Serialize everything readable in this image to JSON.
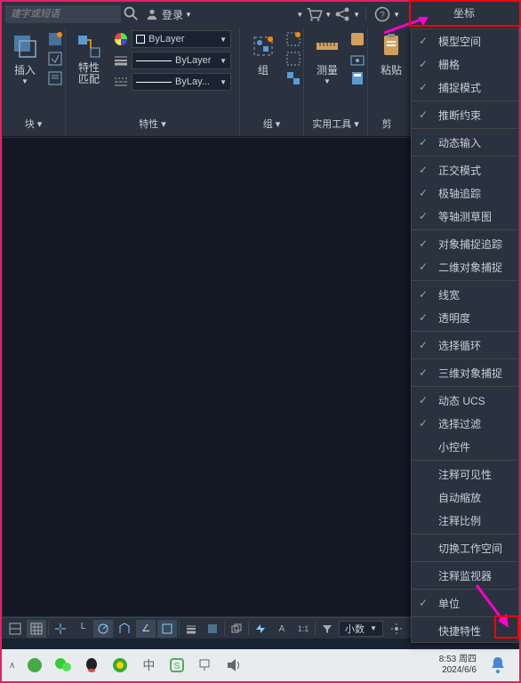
{
  "topbar": {
    "search_placeholder": "建字或短语",
    "login_label": "登录",
    "coord_label": "坐标"
  },
  "ribbon": {
    "panel_block": {
      "insert_label": "插入",
      "title": "块 ▾"
    },
    "panel_props": {
      "match_label": "特性\n匹配",
      "bylayer1": "ByLayer",
      "bylayer2": "ByLayer",
      "bylayer3": "ByLay...",
      "title": "特性 ▾"
    },
    "panel_group": {
      "group_label": "组",
      "title": "组 ▾"
    },
    "panel_tools": {
      "measure_label": "测量",
      "title": "实用工具 ▾"
    },
    "panel_clip": {
      "paste_label": "粘贴",
      "title": "剪"
    }
  },
  "status": {
    "scale_label": "小数"
  },
  "menu": {
    "items": [
      {
        "label": "模型空间",
        "checked": true,
        "sep_after": false
      },
      {
        "label": "栅格",
        "checked": true
      },
      {
        "label": "捕捉模式",
        "checked": true,
        "sep_after": true
      },
      {
        "label": "推断约束",
        "checked": true,
        "sep_after": true
      },
      {
        "label": "动态输入",
        "checked": true,
        "sep_after": true
      },
      {
        "label": "正交模式",
        "checked": true
      },
      {
        "label": "极轴追踪",
        "checked": true
      },
      {
        "label": "等轴测草图",
        "checked": true,
        "sep_after": true
      },
      {
        "label": "对象捕捉追踪",
        "checked": true
      },
      {
        "label": "二维对象捕捉",
        "checked": true,
        "sep_after": true
      },
      {
        "label": "线宽",
        "checked": true
      },
      {
        "label": "透明度",
        "checked": true,
        "sep_after": true
      },
      {
        "label": "选择循环",
        "checked": true,
        "sep_after": true
      },
      {
        "label": "三维对象捕捉",
        "checked": true,
        "sep_after": true
      },
      {
        "label": "动态 UCS",
        "checked": true
      },
      {
        "label": "选择过滤",
        "checked": true
      },
      {
        "label": "小控件",
        "checked": false,
        "sep_after": true
      },
      {
        "label": "注释可见性",
        "checked": false
      },
      {
        "label": "自动缩放",
        "checked": false
      },
      {
        "label": "注释比例",
        "checked": false,
        "sep_after": true
      },
      {
        "label": "切换工作空间",
        "checked": false,
        "sep_after": true
      },
      {
        "label": "注释监视器",
        "checked": false,
        "sep_after": true
      },
      {
        "label": "单位",
        "checked": true,
        "sep_after": true
      },
      {
        "label": "快捷特性",
        "checked": false
      }
    ]
  },
  "taskbar": {
    "time": "8:53 周四",
    "date": "2024/6/6"
  }
}
